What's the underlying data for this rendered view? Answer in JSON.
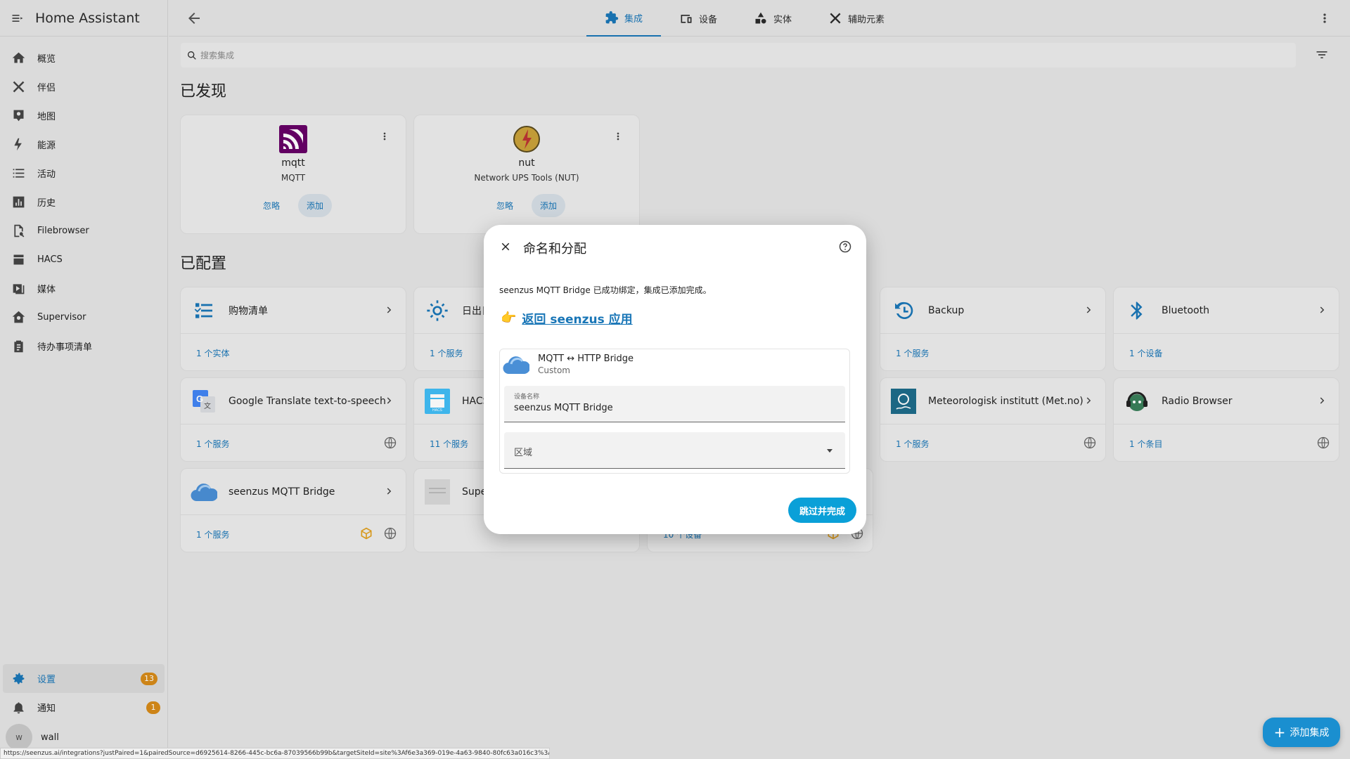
{
  "app": {
    "title": "Home Assistant"
  },
  "sidebar": {
    "items": [
      {
        "label": "概览",
        "icon": "home-icon"
      },
      {
        "label": "伴侣",
        "icon": "tools-icon"
      },
      {
        "label": "地图",
        "icon": "map-icon"
      },
      {
        "label": "能源",
        "icon": "lightning-icon"
      },
      {
        "label": "活动",
        "icon": "list-icon"
      },
      {
        "label": "历史",
        "icon": "chart-icon"
      },
      {
        "label": "Filebrowser",
        "icon": "file-search-icon"
      },
      {
        "label": "HACS",
        "icon": "hacs-icon"
      },
      {
        "label": "媒体",
        "icon": "media-icon"
      },
      {
        "label": "Supervisor",
        "icon": "supervisor-icon"
      },
      {
        "label": "待办事项清单",
        "icon": "clipboard-icon"
      }
    ],
    "settings": {
      "label": "设置",
      "badge": "13"
    },
    "notifications": {
      "label": "通知",
      "badge": "1"
    },
    "user": {
      "initial": "w",
      "name": "wall"
    }
  },
  "topbar": {
    "tabs": [
      {
        "label": "集成",
        "active": true
      },
      {
        "label": "设备",
        "active": false
      },
      {
        "label": "实体",
        "active": false
      },
      {
        "label": "辅助元素",
        "active": false
      }
    ]
  },
  "search": {
    "placeholder": "搜索集成"
  },
  "discovered": {
    "title": "已发现",
    "cards": [
      {
        "name": "mqtt",
        "sub": "MQTT",
        "ignore": "忽略",
        "add": "添加"
      },
      {
        "name": "nut",
        "sub": "Network UPS Tools (NUT)",
        "ignore": "忽略",
        "add": "添加"
      }
    ]
  },
  "configured": {
    "title": "已配置",
    "cards": [
      {
        "name": "购物清单",
        "footer": "1 个实体"
      },
      {
        "name": "日出日",
        "footer": "1 个服务"
      },
      {
        "name": "Backup",
        "footer": "1 个服务"
      },
      {
        "name": "Bluetooth",
        "footer": "1 个设备"
      },
      {
        "name": "Google Translate text-to-speech",
        "footer": "1 个服务"
      },
      {
        "name": "HACS",
        "footer": "11 个服务"
      },
      {
        "name": "Meteorologisk institutt (Met.no)",
        "footer": "1 个服务"
      },
      {
        "name": "Radio Browser",
        "footer": "1 个条目"
      },
      {
        "name": "seenzus MQTT Bridge",
        "footer": "1 个服务"
      },
      {
        "name": "Supe",
        "footer": ""
      },
      {
        "name": "",
        "footer": "10 个设备"
      }
    ]
  },
  "dialog": {
    "title": "命名和分配",
    "message": "seenzus MQTT Bridge 已成功绑定，集成已添加完成。",
    "link": "返回 seenzus 应用",
    "device": {
      "name": "MQTT ↔ HTTP Bridge",
      "sub": "Custom",
      "field_label": "设备名称",
      "field_value": "seenzus MQTT Bridge",
      "area_label": "区域"
    },
    "button": "跳过并完成"
  },
  "fab": {
    "label": "添加集成"
  },
  "status_url": "https://seenzus.ai/integrations?justPaired=1&pairedSource=d6925614-8266-445c-bc6a-87039566b99b&targetSiteId=site%3Af6e3a369-019e-4a63-9840-80fc63a016c3%3Adefault",
  "colors": {
    "accent": "#1976b7",
    "badge": "#d68a18",
    "primary_button": "#0aa0d8"
  }
}
